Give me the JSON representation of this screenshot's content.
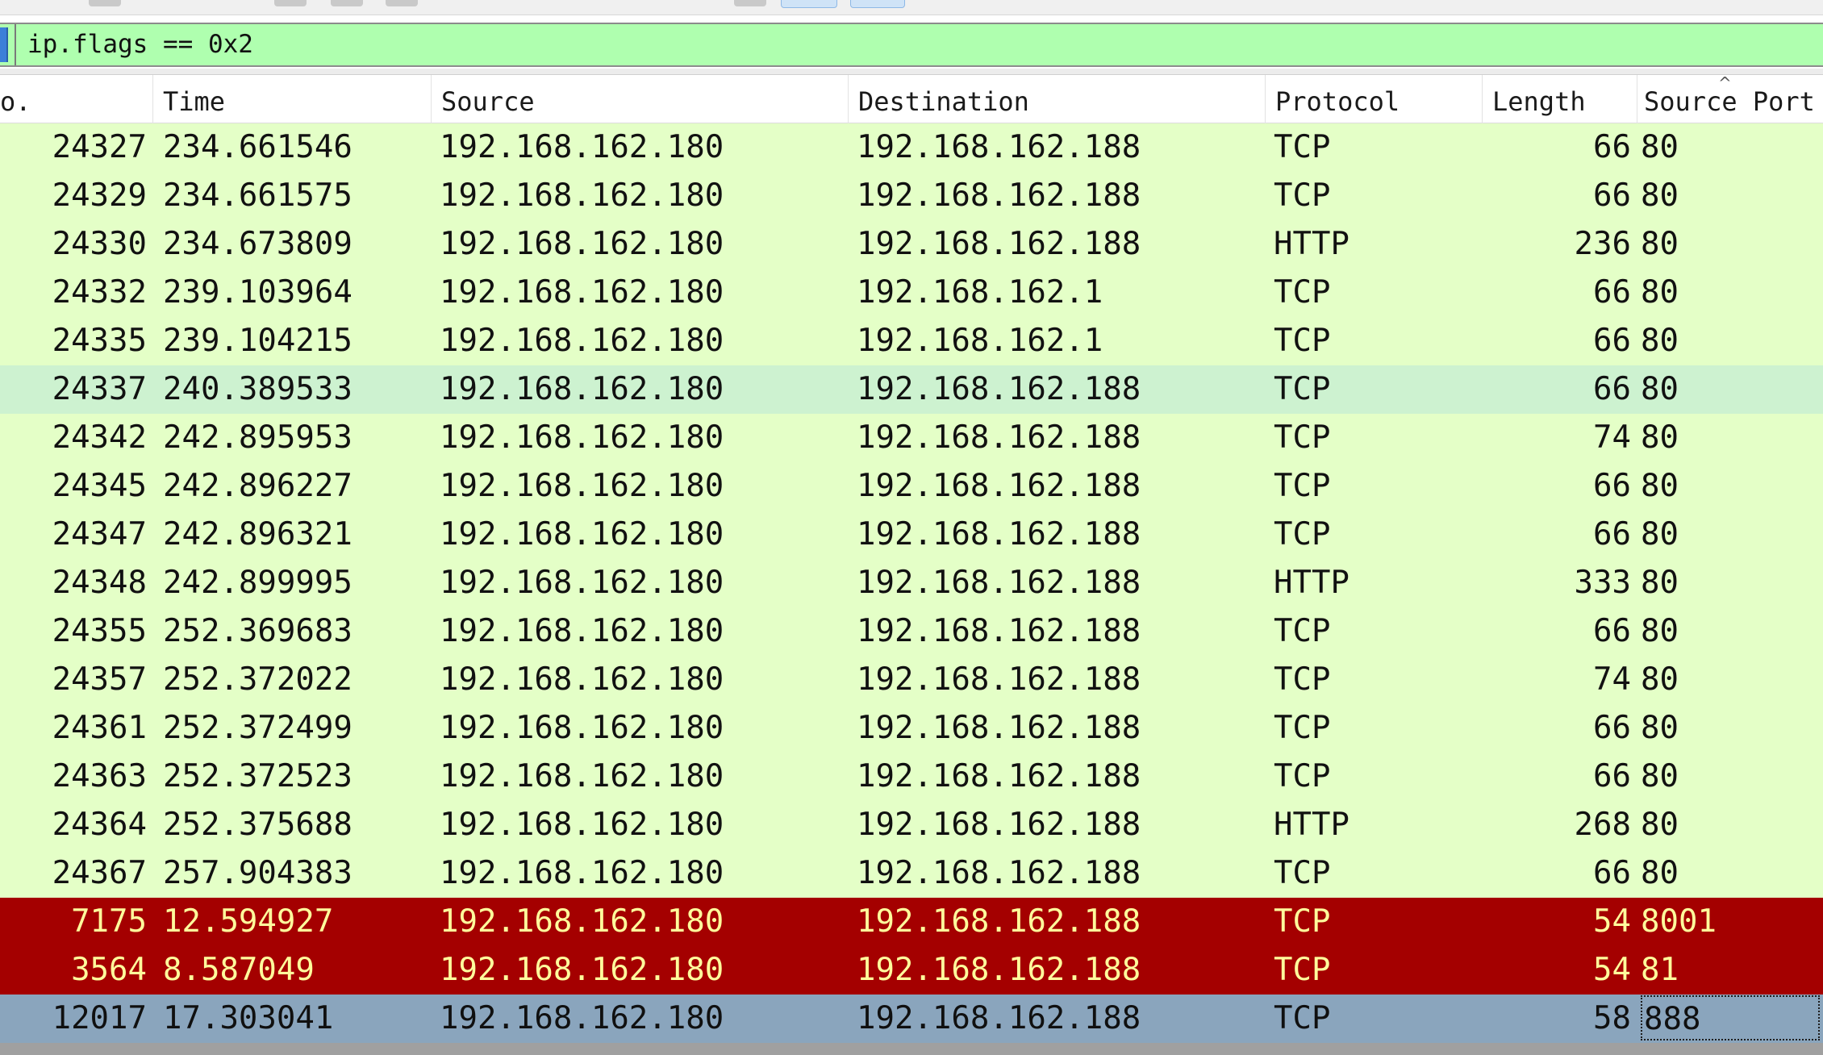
{
  "filter": {
    "value": "ip.flags == 0x2"
  },
  "columns": {
    "no": "o.",
    "time": "Time",
    "source": "Source",
    "destination": "Destination",
    "protocol": "Protocol",
    "length": "Length",
    "source_port": "Source Port"
  },
  "sort_indicator": "^",
  "rows": [
    {
      "no": "24327",
      "time": "234.661546",
      "source": "192.168.162.180",
      "destination": "192.168.162.188",
      "protocol": "TCP",
      "length": "66",
      "source_port": "80",
      "color": "green"
    },
    {
      "no": "24329",
      "time": "234.661575",
      "source": "192.168.162.180",
      "destination": "192.168.162.188",
      "protocol": "TCP",
      "length": "66",
      "source_port": "80",
      "color": "green"
    },
    {
      "no": "24330",
      "time": "234.673809",
      "source": "192.168.162.180",
      "destination": "192.168.162.188",
      "protocol": "HTTP",
      "length": "236",
      "source_port": "80",
      "color": "green"
    },
    {
      "no": "24332",
      "time": "239.103964",
      "source": "192.168.162.180",
      "destination": "192.168.162.1",
      "protocol": "TCP",
      "length": "66",
      "source_port": "80",
      "color": "green"
    },
    {
      "no": "24335",
      "time": "239.104215",
      "source": "192.168.162.180",
      "destination": "192.168.162.1",
      "protocol": "TCP",
      "length": "66",
      "source_port": "80",
      "color": "green"
    },
    {
      "no": "24337",
      "time": "240.389533",
      "source": "192.168.162.180",
      "destination": "192.168.162.188",
      "protocol": "TCP",
      "length": "66",
      "source_port": "80",
      "color": "greensel"
    },
    {
      "no": "24342",
      "time": "242.895953",
      "source": "192.168.162.180",
      "destination": "192.168.162.188",
      "protocol": "TCP",
      "length": "74",
      "source_port": "80",
      "color": "green"
    },
    {
      "no": "24345",
      "time": "242.896227",
      "source": "192.168.162.180",
      "destination": "192.168.162.188",
      "protocol": "TCP",
      "length": "66",
      "source_port": "80",
      "color": "green"
    },
    {
      "no": "24347",
      "time": "242.896321",
      "source": "192.168.162.180",
      "destination": "192.168.162.188",
      "protocol": "TCP",
      "length": "66",
      "source_port": "80",
      "color": "green"
    },
    {
      "no": "24348",
      "time": "242.899995",
      "source": "192.168.162.180",
      "destination": "192.168.162.188",
      "protocol": "HTTP",
      "length": "333",
      "source_port": "80",
      "color": "green"
    },
    {
      "no": "24355",
      "time": "252.369683",
      "source": "192.168.162.180",
      "destination": "192.168.162.188",
      "protocol": "TCP",
      "length": "66",
      "source_port": "80",
      "color": "green"
    },
    {
      "no": "24357",
      "time": "252.372022",
      "source": "192.168.162.180",
      "destination": "192.168.162.188",
      "protocol": "TCP",
      "length": "74",
      "source_port": "80",
      "color": "green"
    },
    {
      "no": "24361",
      "time": "252.372499",
      "source": "192.168.162.180",
      "destination": "192.168.162.188",
      "protocol": "TCP",
      "length": "66",
      "source_port": "80",
      "color": "green"
    },
    {
      "no": "24363",
      "time": "252.372523",
      "source": "192.168.162.180",
      "destination": "192.168.162.188",
      "protocol": "TCP",
      "length": "66",
      "source_port": "80",
      "color": "green"
    },
    {
      "no": "24364",
      "time": "252.375688",
      "source": "192.168.162.180",
      "destination": "192.168.162.188",
      "protocol": "HTTP",
      "length": "268",
      "source_port": "80",
      "color": "green"
    },
    {
      "no": "24367",
      "time": "257.904383",
      "source": "192.168.162.180",
      "destination": "192.168.162.188",
      "protocol": "TCP",
      "length": "66",
      "source_port": "80",
      "color": "green"
    },
    {
      "no": "7175",
      "time": "12.594927",
      "source": "192.168.162.180",
      "destination": "192.168.162.188",
      "protocol": "TCP",
      "length": "54",
      "source_port": "8001",
      "color": "red"
    },
    {
      "no": "3564",
      "time": "8.587049",
      "source": "192.168.162.180",
      "destination": "192.168.162.188",
      "protocol": "TCP",
      "length": "54",
      "source_port": "81",
      "color": "red"
    },
    {
      "no": "12017",
      "time": "17.303041",
      "source": "192.168.162.180",
      "destination": "192.168.162.188",
      "protocol": "TCP",
      "length": "58",
      "source_port": "888",
      "color": "blue",
      "focused": true
    }
  ],
  "colors": {
    "green": "#e4ffc7",
    "greensel": "#cdf2d0",
    "red": "#a40000",
    "red_text": "#fffc9c",
    "blue": "#8aa5bd",
    "filter_bg": "#afffaf"
  }
}
